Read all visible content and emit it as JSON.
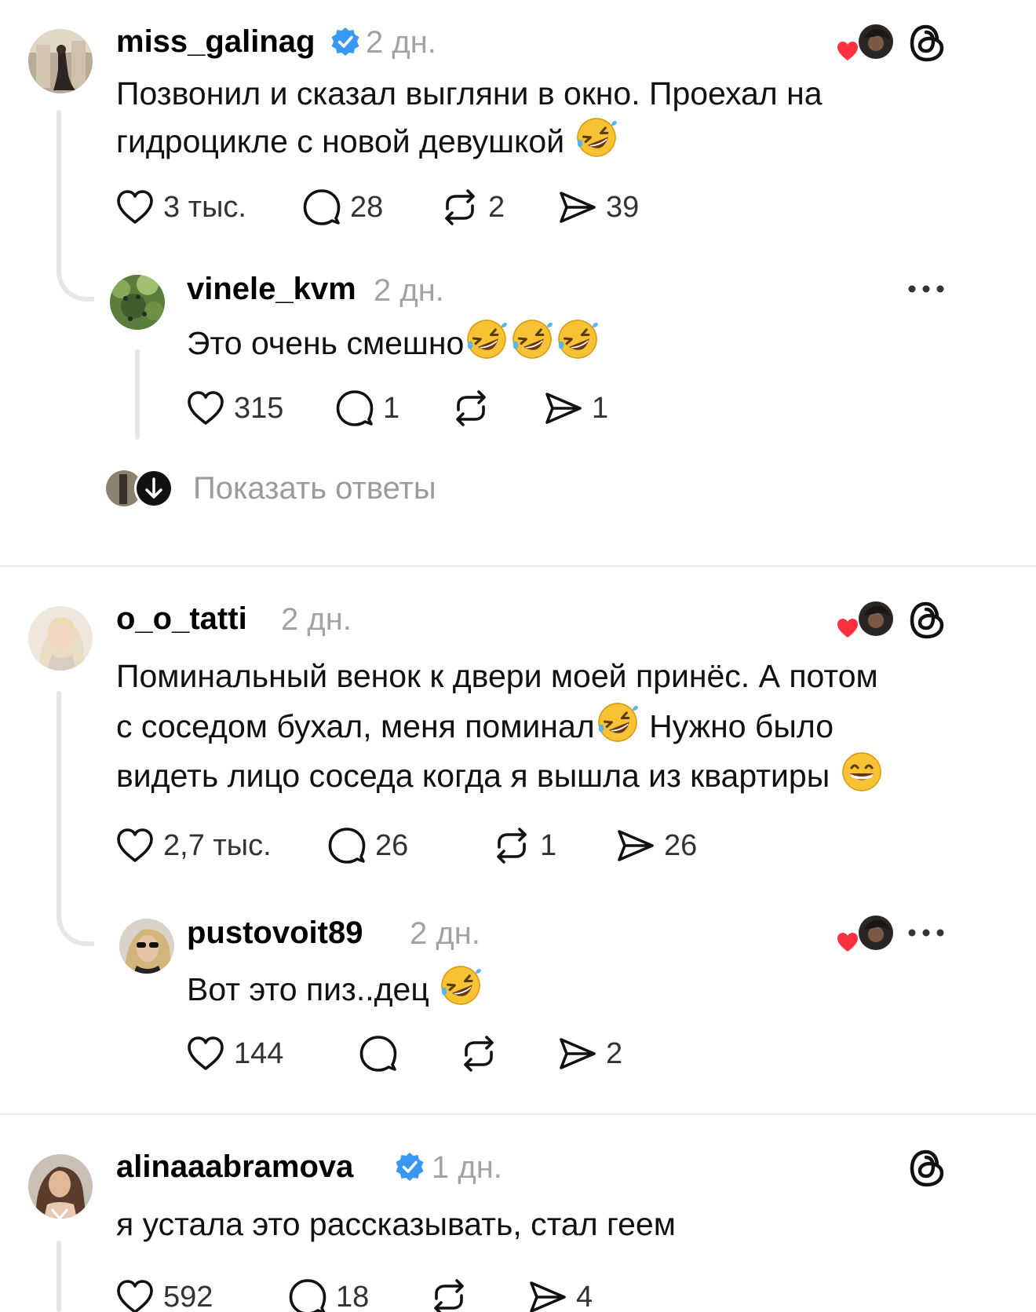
{
  "colors": {
    "verified": "#3897f0",
    "heart": "#ff3040",
    "muted": "#a3a3a3",
    "line": "#e6e6e6"
  },
  "posts": [
    {
      "username": "miss_galinag",
      "verified": true,
      "time": "2 дн.",
      "lines": [
        "Позвонил и сказал выгляни в окно. Проехал на",
        "гидроцикле с новой девушкой"
      ],
      "actions": {
        "likes": "3 тыс.",
        "comments": "28",
        "reposts": "2",
        "shares": "39"
      },
      "reply": {
        "username": "vinele_kvm",
        "time": "2 дн.",
        "lines": [
          "Это очень смешно"
        ],
        "actions": {
          "likes": "315",
          "comments": "1",
          "reposts": "",
          "shares": "1"
        }
      },
      "show_replies": "Показать ответы"
    },
    {
      "username": "o_o_tatti",
      "verified": false,
      "time": "2 дн.",
      "lines": [
        "Поминальный венок к двери моей принёс. А потом",
        "с соседом бухал, меня поминал",
        "Нужно было",
        "видеть лицо соседа когда я вышла из квартиры"
      ],
      "actions": {
        "likes": "2,7 тыс.",
        "comments": "26",
        "reposts": "1",
        "shares": "26"
      },
      "reply": {
        "username": "pustovoit89",
        "time": "2 дн.",
        "lines": [
          "Вот это пиз..дец"
        ],
        "actions": {
          "likes": "144",
          "comments": "",
          "reposts": "",
          "shares": "2"
        }
      }
    },
    {
      "username": "alinaaabramova",
      "verified": true,
      "time": "1 дн.",
      "lines": [
        "я устала это рассказывать, стал геем"
      ],
      "actions": {
        "likes": "592",
        "comments": "18",
        "reposts": "",
        "shares": "4"
      }
    }
  ]
}
